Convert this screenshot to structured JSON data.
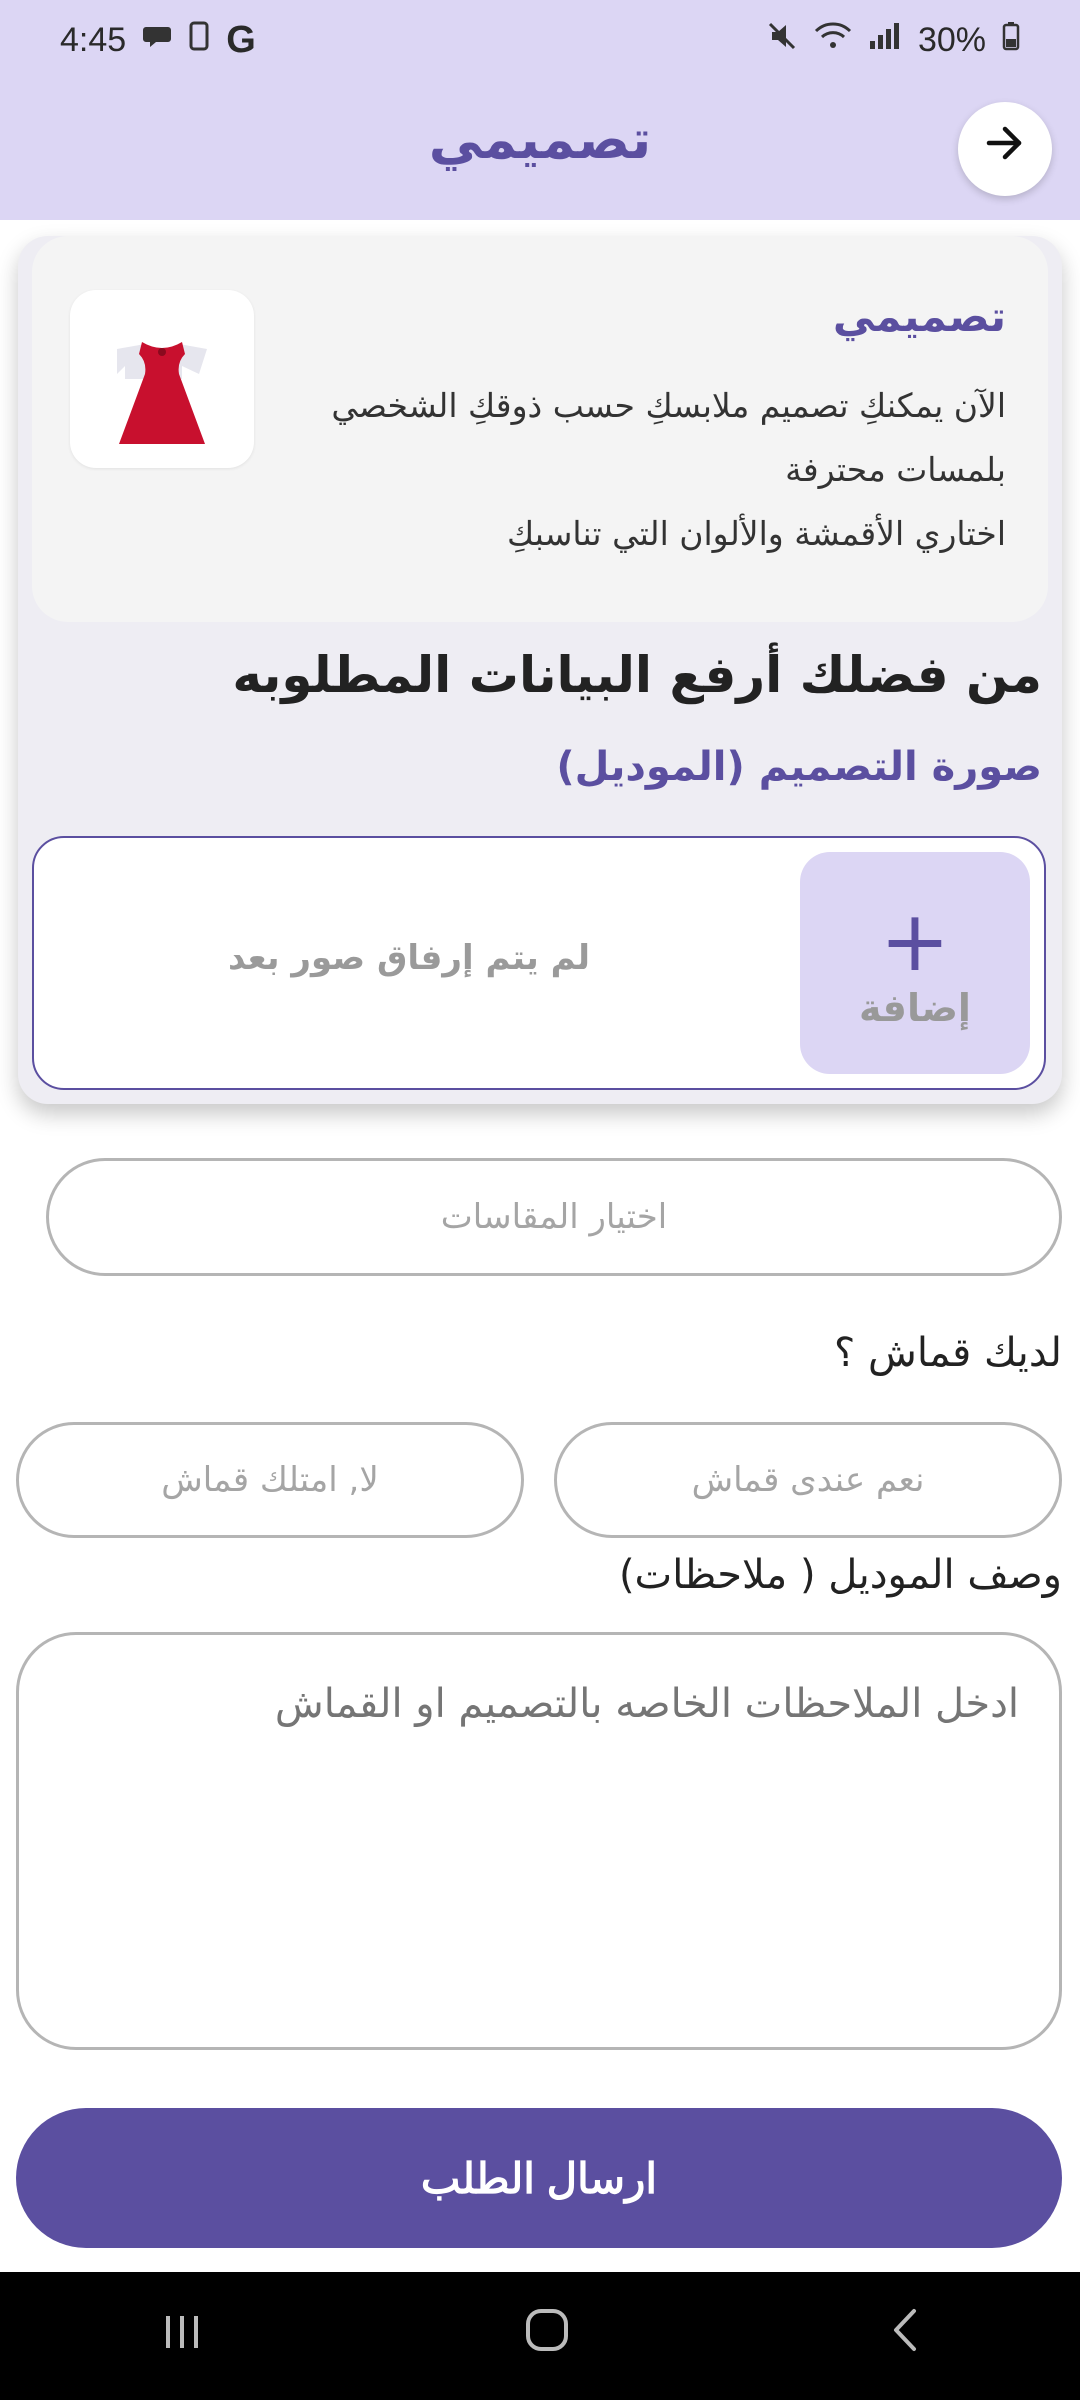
{
  "status": {
    "time": "4:45",
    "battery": "30%"
  },
  "app": {
    "title": "تصميمي",
    "back_icon": "arrow-right-icon"
  },
  "promo": {
    "title": "تصميمي",
    "line1": "الآن يمكنكِ تصميم ملابسكِ حسب ذوقكِ الشخصي",
    "line2": "بلمسات محترفة",
    "line3": "اختاري الأقمشة والألوان التي تناسبكِ"
  },
  "upload": {
    "heading": "من فضلك أرفع البيانات المطلوبه",
    "subheading": "صورة التصميم (الموديل)",
    "add_label": "إضافة",
    "add_icon": "plus-icon",
    "empty_text": "لم يتم إرفاق صور بعد"
  },
  "sizes": {
    "label": "اختيار المقاسات"
  },
  "fabric": {
    "question": "لديك قماش ؟",
    "yes_option": "نعم عندى قماش",
    "no_option": "لا, امتلك قماش"
  },
  "notes": {
    "label": "وصف الموديل ( ملاحظات)",
    "placeholder": "ادخل الملاحظات الخاصه بالتصميم او القماش"
  },
  "submit": {
    "label": "ارسال الطلب"
  },
  "colors": {
    "accent": "#5b4fa0",
    "header_bg": "#dcd6f4"
  }
}
